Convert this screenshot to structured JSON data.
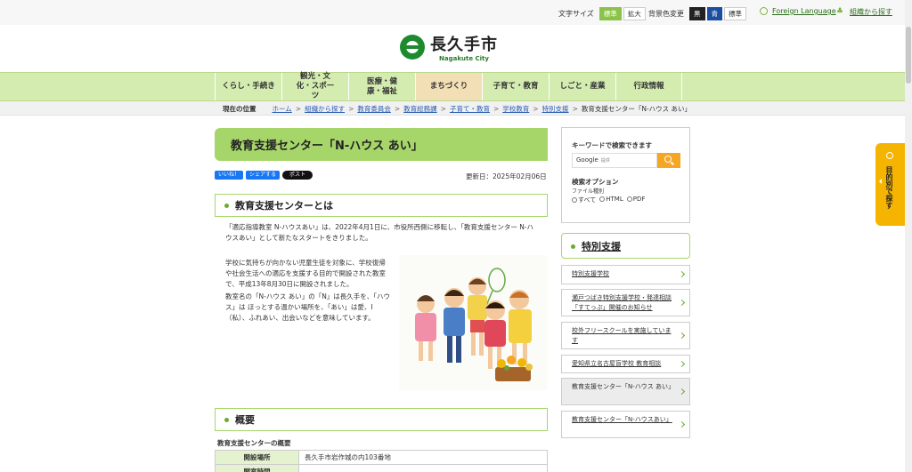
{
  "util": {
    "font_size_label": "文字サイズ",
    "font_standard": "標準",
    "font_large": "拡大",
    "bg_label": "背景色変更",
    "bg_black": "黒",
    "bg_blue": "青",
    "bg_standard": "標準",
    "foreign": "Foreign Language",
    "org": "組織から探す"
  },
  "logo": {
    "name": "長久手市",
    "en": "Nagakute City"
  },
  "nav": [
    {
      "label": "くらし・手続き"
    },
    {
      "label": "観光・文化・スポーツ"
    },
    {
      "label": "医療・健康・福祉"
    },
    {
      "label": "まちづくり"
    },
    {
      "label": "子育て・教育"
    },
    {
      "label": "しごと・産業"
    },
    {
      "label": "行政情報"
    }
  ],
  "breadcrumb": {
    "here": "現在の位置",
    "items": [
      "ホーム",
      "組織から探す",
      "教育委員会",
      "教育総務課",
      "子育て・教育",
      "学校教育",
      "特別支援"
    ],
    "current": "教育支援センター「N-ハウス あい」"
  },
  "page": {
    "title": "教育支援センター「N-ハウス あい」",
    "like": "いいね！",
    "share": "シェアする",
    "post": "ポスト",
    "updated": "更新日：2025年02月06日",
    "h2_about": "教育支援センターとは",
    "p1a": "「適応指導教室 N-ハウスあい」は、2022年4月1日に、市役所西側に移転し、「教育支援センター N-ハ",
    "p1b": "ウスあい」として新たなスタートをきりました。",
    "p2": [
      "学校に気持ちが向かない児童生徒を対象に、学校復帰",
      "や社会生活への適応を支援する目的で開設された教室",
      "で、平成13年8月30日に開設されました。"
    ],
    "p3": [
      "教室名の「N-ハウス あい」の「N」は長久手を、「ハウ",
      "ス」は ほっとする温かい場所を、「あい」は愛、I",
      "（私）、ふれあい、出会いなどを意味しています。"
    ],
    "h2_overview": "概要",
    "table_title": "教育支援センターの概要",
    "table": [
      {
        "th": "開設場所",
        "td": "長久手市岩作城の内103番地"
      },
      {
        "th": "開室時間",
        "td": ""
      }
    ]
  },
  "search": {
    "title": "キーワードで検索できます",
    "placeholder": "Google",
    "enhanced": "提供",
    "options": "検索オプション",
    "filetype": "ファイル種別",
    "radios": [
      "すべて",
      "HTML",
      "PDF"
    ]
  },
  "side": {
    "heading": "特別支援",
    "items": [
      {
        "label": "特別支援学校"
      },
      {
        "label": "瀬戸つばき特別支援学校・発達相談「すてっぷ」開催のお知らせ"
      },
      {
        "label": "校外フリースクールを実施しています"
      },
      {
        "label": "愛知県立名古屋盲学校 教育相談"
      },
      {
        "label": "教育支援センター「N-ハウス あい」"
      },
      {
        "label": "教育支援センター「N-ハウスあい」"
      }
    ]
  },
  "float_tab": {
    "label": "目的別で探す"
  }
}
